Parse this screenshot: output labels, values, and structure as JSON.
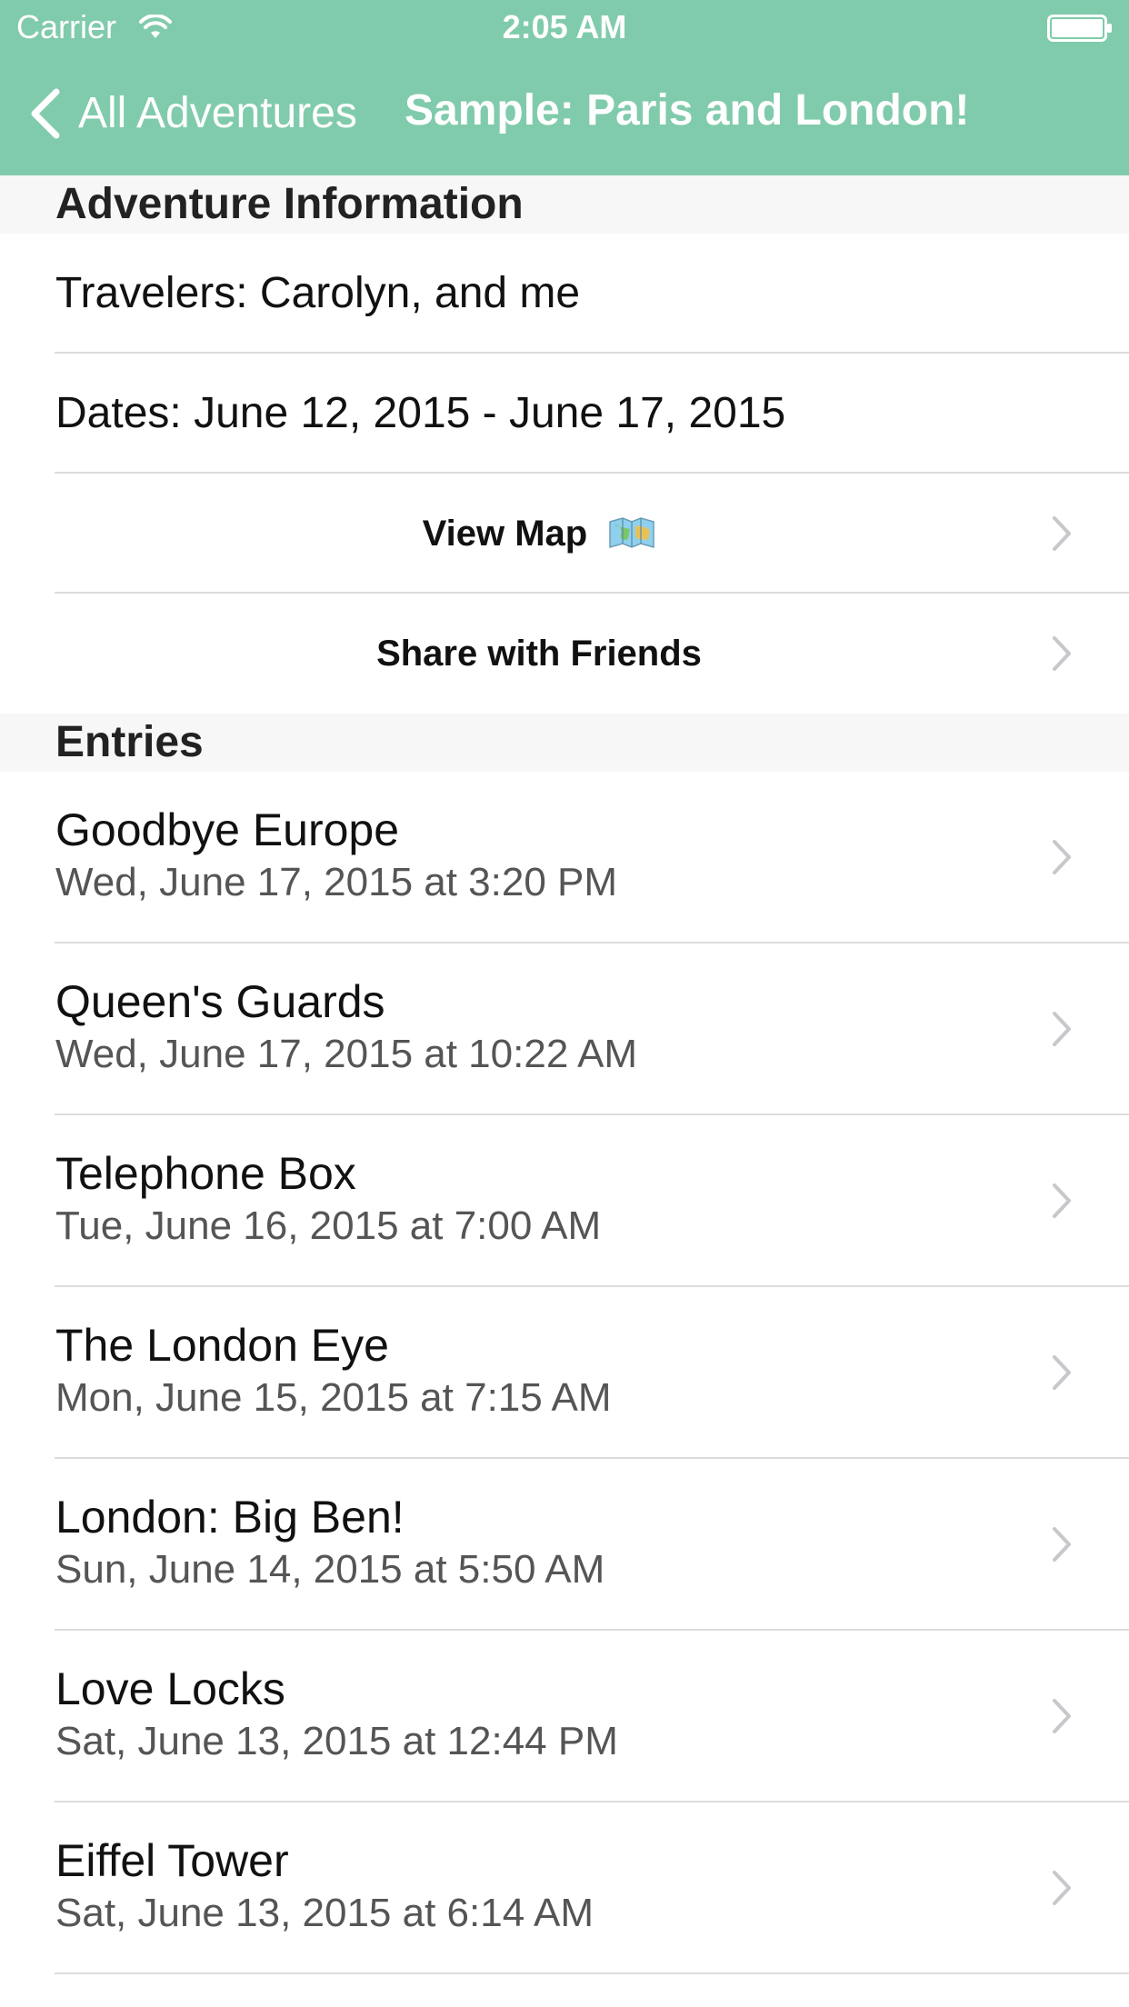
{
  "status_bar": {
    "carrier": "Carrier",
    "time": "2:05 AM",
    "icons": [
      "wifi-icon",
      "battery-icon"
    ]
  },
  "nav": {
    "back_label": "All Adventures",
    "title": "Sample: Paris and London!",
    "back_icon": "chevron-left-icon"
  },
  "colors": {
    "nav_background": "#80cbab",
    "nav_text": "#ffffff",
    "section_header_background": "#f7f7f7",
    "separator": "#dcdcdc",
    "disclosure": "#c7c7cc"
  },
  "sections": {
    "info": {
      "header": "Adventure Information",
      "travelers": "Travelers: Carolyn, and me",
      "dates": "Dates: June 12, 2015 - June 17, 2015",
      "view_map": "View Map",
      "view_map_icon": "map-emoji-icon",
      "share": "Share with Friends"
    },
    "entries": {
      "header": "Entries",
      "items": [
        {
          "title": "Goodbye Europe",
          "subtitle": "Wed, June 17, 2015 at 3:20 PM"
        },
        {
          "title": "Queen's Guards",
          "subtitle": "Wed, June 17, 2015 at 10:22 AM"
        },
        {
          "title": "Telephone Box",
          "subtitle": "Tue, June 16, 2015 at 7:00 AM"
        },
        {
          "title": "The London Eye",
          "subtitle": "Mon, June 15, 2015 at 7:15 AM"
        },
        {
          "title": "London: Big Ben!",
          "subtitle": "Sun, June 14, 2015 at 5:50 AM"
        },
        {
          "title": "Love Locks",
          "subtitle": "Sat, June 13, 2015 at 12:44 PM"
        },
        {
          "title": "Eiffel Tower",
          "subtitle": "Sat, June 13, 2015 at 6:14 AM"
        }
      ]
    }
  }
}
